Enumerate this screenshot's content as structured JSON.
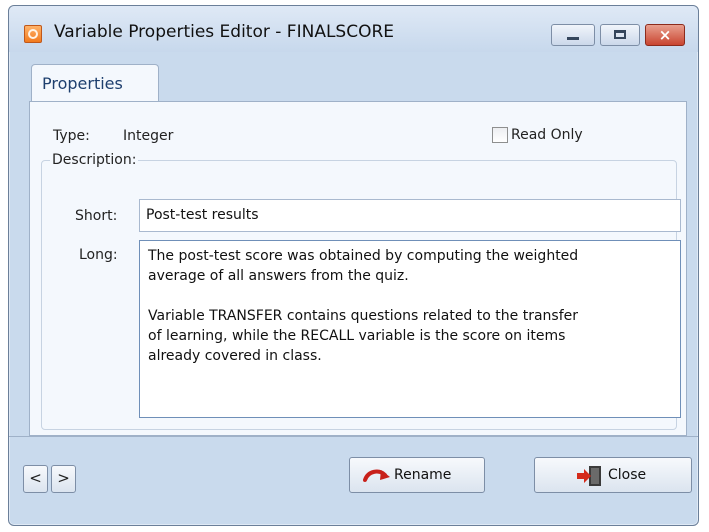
{
  "window": {
    "title": "Variable Properties Editor - FINALSCORE",
    "controls": {
      "close_glyph": "×"
    }
  },
  "tabs": [
    {
      "label": "Properties"
    }
  ],
  "properties": {
    "type_label": "Type:",
    "type_value": "Integer",
    "read_only_label": "Read Only",
    "read_only_checked": false,
    "description_legend": "Description:",
    "short_label": "Short:",
    "short_value": "Post-test results",
    "long_label": "Long:",
    "long_value": "The post-test score was obtained by computing the weighted\naverage of all answers from the quiz.\n\nVariable TRANSFER contains questions related to the transfer\nof learning, while the RECALL variable is the score on items\nalready covered in class."
  },
  "footer": {
    "prev_label": "<",
    "next_label": ">",
    "rename_label": "Rename",
    "close_label": "Close"
  },
  "icons": {
    "app": "app-icon",
    "rename": "rename-arrow-icon",
    "close": "door-exit-icon"
  },
  "colors": {
    "accent_red": "#c8201a",
    "titlebar": "#c9daed"
  }
}
